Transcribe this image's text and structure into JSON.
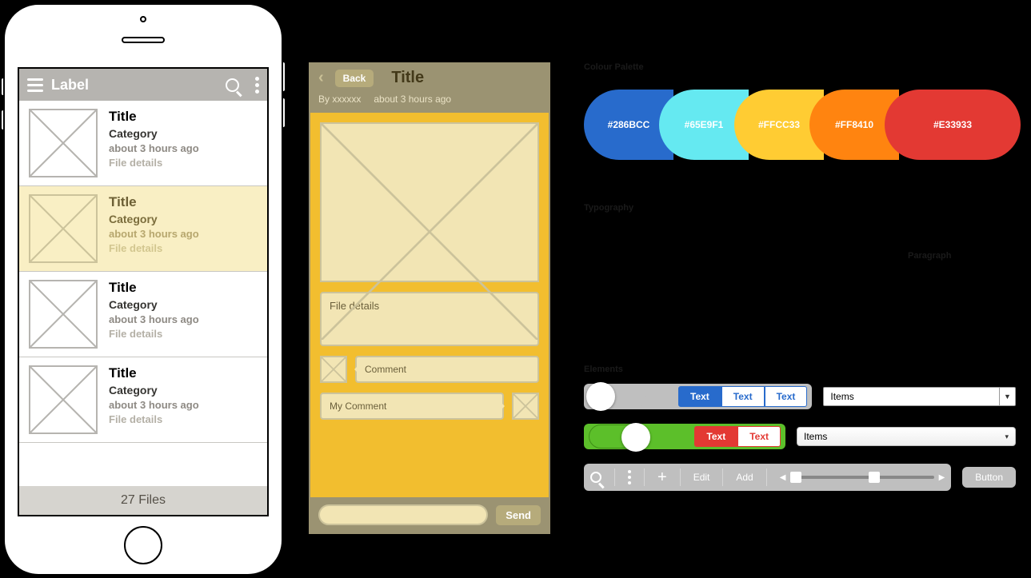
{
  "phone": {
    "appbar": {
      "title": "Label"
    },
    "rows": [
      {
        "title": "Title",
        "category": "Category",
        "time": "about 3 hours ago",
        "details": "File details",
        "highlight": false
      },
      {
        "title": "Title",
        "category": "Category",
        "time": "about 3 hours ago",
        "details": "File details",
        "highlight": true
      },
      {
        "title": "Title",
        "category": "Category",
        "time": "about 3 hours ago",
        "details": "File details",
        "highlight": false
      },
      {
        "title": "Title",
        "category": "Category",
        "time": "about 3 hours ago",
        "details": "File details",
        "highlight": false
      }
    ],
    "footer": "27 Files"
  },
  "detail": {
    "back": "Back",
    "title": "Title",
    "author": "By xxxxxx",
    "time": "about 3 hours ago",
    "file_details": "File details",
    "comment": "Comment",
    "my_comment": "My Comment",
    "send": "Send"
  },
  "sections": {
    "colors": "Colour Palette",
    "typography": "Typography",
    "paragraph": "Paragraph",
    "elements": "Elements"
  },
  "palette": [
    {
      "hex": "#286BCC"
    },
    {
      "hex": "#65E9F1"
    },
    {
      "hex": "#FFCC33"
    },
    {
      "hex": "#FF8410"
    },
    {
      "hex": "#E33933"
    }
  ],
  "elements": {
    "seg_blue": [
      "Text",
      "Text",
      "Text"
    ],
    "seg_red": [
      "Text",
      "Text"
    ],
    "select1": "Items",
    "select2": "Items",
    "toolbar": {
      "edit": "Edit",
      "add": "Add",
      "button": "Button"
    }
  }
}
